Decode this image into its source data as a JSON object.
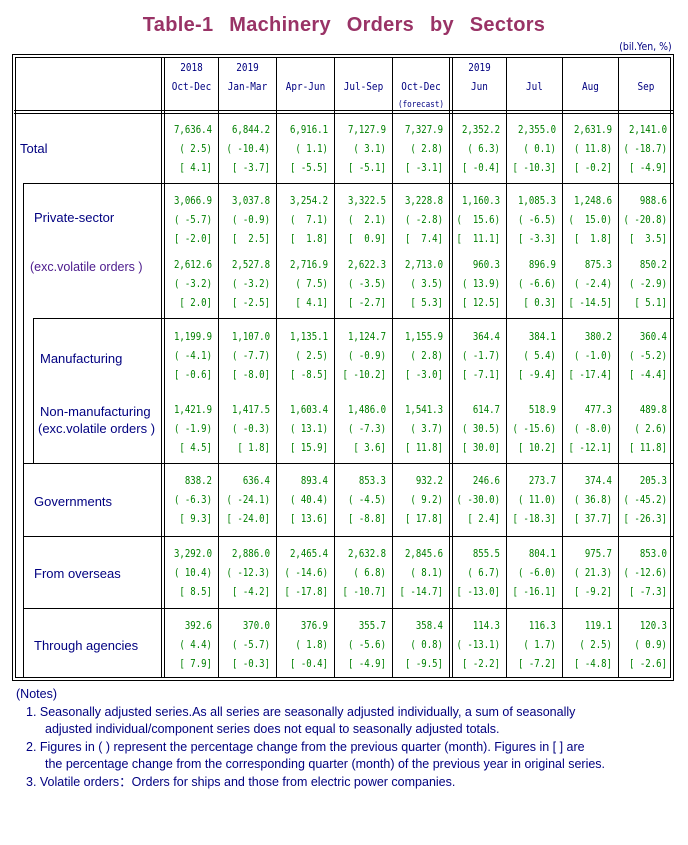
{
  "title": "Table-1   Machinery   Orders   by   Sectors",
  "unit": "(bil.Yen, %)",
  "columns": [
    {
      "year": "2018",
      "period": "Oct-Dec",
      "note": ""
    },
    {
      "year": "2019",
      "period": "Jan-Mar",
      "note": ""
    },
    {
      "year": "",
      "period": "Apr-Jun",
      "note": ""
    },
    {
      "year": "",
      "period": "Jul-Sep",
      "note": ""
    },
    {
      "year": "",
      "period": "Oct-Dec",
      "note": "(forecast)"
    },
    {
      "year": "2019",
      "period": "Jun",
      "note": ""
    },
    {
      "year": "",
      "period": "Jul",
      "note": ""
    },
    {
      "year": "",
      "period": "Aug",
      "note": ""
    },
    {
      "year": "",
      "period": "Sep",
      "note": ""
    }
  ],
  "rows": [
    {
      "label": "Total",
      "label2": "",
      "level": [
        "7,636.4",
        "6,844.2",
        "6,916.1",
        "7,127.9",
        "7,327.9",
        "2,352.2",
        "2,355.0",
        "2,631.9",
        "2,141.0"
      ],
      "mom": [
        "( 2.5)",
        "( -10.4)",
        "( 1.1)",
        "( 3.1)",
        "( 2.8)",
        "( 6.3)",
        "( 0.1)",
        "( 11.8)",
        "( -18.7)"
      ],
      "yoy": [
        "[ 4.1]",
        "[ -3.7]",
        "[ -5.5]",
        "[ -5.1]",
        "[ -3.1]",
        "[ -0.4]",
        "[ -10.3]",
        "[ -0.2]",
        "[ -4.9]"
      ]
    },
    {
      "label": "Private-sector",
      "label2": "",
      "level": [
        "3,066.9",
        "3,037.8",
        "3,254.2",
        "3,322.5",
        "3,228.8",
        "1,160.3",
        "1,085.3",
        "1,248.6",
        "988.6"
      ],
      "mom": [
        "( -5.7)",
        "( -0.9)",
        "(  7.1)",
        "(  2.1)",
        "( -2.8)",
        "(  15.6)",
        "( -6.5)",
        "(  15.0)",
        "( -20.8)"
      ],
      "yoy": [
        "[ -2.0]",
        "[  2.5]",
        "[  1.8]",
        "[  0.9]",
        "[  7.4]",
        "[  11.1]",
        "[ -3.3]",
        "[  1.8]",
        "[  3.5]"
      ]
    },
    {
      "label": "(exc.volatile orders )",
      "label2": "",
      "level": [
        "2,612.6",
        "2,527.8",
        "2,716.9",
        "2,622.3",
        "2,713.0",
        "960.3",
        "896.9",
        "875.3",
        "850.2"
      ],
      "mom": [
        "( -3.2)",
        "( -3.2)",
        "( 7.5)",
        "( -3.5)",
        "( 3.5)",
        "( 13.9)",
        "( -6.6)",
        "( -2.4)",
        "( -2.9)"
      ],
      "yoy": [
        "[ 2.0]",
        "[ -2.5]",
        "[ 4.1]",
        "[ -2.7]",
        "[ 5.3]",
        "[ 12.5]",
        "[ 0.3]",
        "[ -14.5]",
        "[ 5.1]"
      ]
    },
    {
      "label": "Manufacturing",
      "label2": "",
      "level": [
        "1,199.9",
        "1,107.0",
        "1,135.1",
        "1,124.7",
        "1,155.9",
        "364.4",
        "384.1",
        "380.2",
        "360.4"
      ],
      "mom": [
        "( -4.1)",
        "( -7.7)",
        "( 2.5)",
        "( -0.9)",
        "( 2.8)",
        "( -1.7)",
        "( 5.4)",
        "( -1.0)",
        "( -5.2)"
      ],
      "yoy": [
        "[ -0.6]",
        "[ -8.0]",
        "[ -8.5]",
        "[ -10.2]",
        "[ -3.0]",
        "[ -7.1]",
        "[ -9.4]",
        "[ -17.4]",
        "[ -4.4]"
      ]
    },
    {
      "label": "Non-manufacturing",
      "label2": "(exc.volatile orders )",
      "level": [
        "1,421.9",
        "1,417.5",
        "1,603.4",
        "1,486.0",
        "1,541.3",
        "614.7",
        "518.9",
        "477.3",
        "489.8"
      ],
      "mom": [
        "( -1.9)",
        "( -0.3)",
        "( 13.1)",
        "( -7.3)",
        "( 3.7)",
        "( 30.5)",
        "( -15.6)",
        "( -8.0)",
        "( 2.6)"
      ],
      "yoy": [
        "[ 4.5]",
        "[ 1.8]",
        "[ 15.9]",
        "[ 3.6]",
        "[ 11.8]",
        "[ 30.0]",
        "[ 10.2]",
        "[ -12.1]",
        "[ 11.8]"
      ]
    },
    {
      "label": "Governments",
      "label2": "",
      "level": [
        "838.2",
        "636.4",
        "893.4",
        "853.3",
        "932.2",
        "246.6",
        "273.7",
        "374.4",
        "205.3"
      ],
      "mom": [
        "( -6.3)",
        "( -24.1)",
        "( 40.4)",
        "( -4.5)",
        "( 9.2)",
        "( -30.0)",
        "( 11.0)",
        "( 36.8)",
        "( -45.2)"
      ],
      "yoy": [
        "[ 9.3]",
        "[ -24.0]",
        "[ 13.6]",
        "[ -8.8]",
        "[ 17.8]",
        "[ 2.4]",
        "[ -18.3]",
        "[ 37.7]",
        "[ -26.3]"
      ]
    },
    {
      "label": "From overseas",
      "label2": "",
      "level": [
        "3,292.0",
        "2,886.0",
        "2,465.4",
        "2,632.8",
        "2,845.6",
        "855.5",
        "804.1",
        "975.7",
        "853.0"
      ],
      "mom": [
        "( 10.4)",
        "( -12.3)",
        "( -14.6)",
        "( 6.8)",
        "( 8.1)",
        "( 6.7)",
        "( -6.0)",
        "( 21.3)",
        "( -12.6)"
      ],
      "yoy": [
        "[ 8.5]",
        "[ -4.2]",
        "[ -17.8]",
        "[ -10.7]",
        "[ -14.7]",
        "[ -13.0]",
        "[ -16.1]",
        "[ -9.2]",
        "[ -7.3]"
      ]
    },
    {
      "label": "Through agencies",
      "label2": "",
      "level": [
        "392.6",
        "370.0",
        "376.9",
        "355.7",
        "358.4",
        "114.3",
        "116.3",
        "119.1",
        "120.3"
      ],
      "mom": [
        "( 4.4)",
        "( -5.7)",
        "( 1.8)",
        "( -5.6)",
        "( 0.8)",
        "( -13.1)",
        "( 1.7)",
        "( 2.5)",
        "( 0.9)"
      ],
      "yoy": [
        "[ 7.9]",
        "[ -0.3]",
        "[ -0.4]",
        "[ -4.9]",
        "[ -9.5]",
        "[ -2.2]",
        "[ -7.2]",
        "[ -4.8]",
        "[ -2.6]"
      ]
    }
  ],
  "notes": {
    "heading": "(Notes)",
    "items": [
      "1. Seasonally adjusted series.As all series are seasonally adjusted individually, a sum of seasonally",
      "adjusted individual/component series does not equal to seasonally adjusted totals.",
      "2. Figures in ( ) represent the percentage change from the previous quarter (month). Figures in [ ] are",
      "the percentage change from the corresponding quarter (month) of the previous year in original series.",
      "3. Volatile orders：Orders for ships and those from electric power companies."
    ]
  },
  "colors": {
    "title": "#993366",
    "label": "#000080",
    "value": "#008000"
  }
}
